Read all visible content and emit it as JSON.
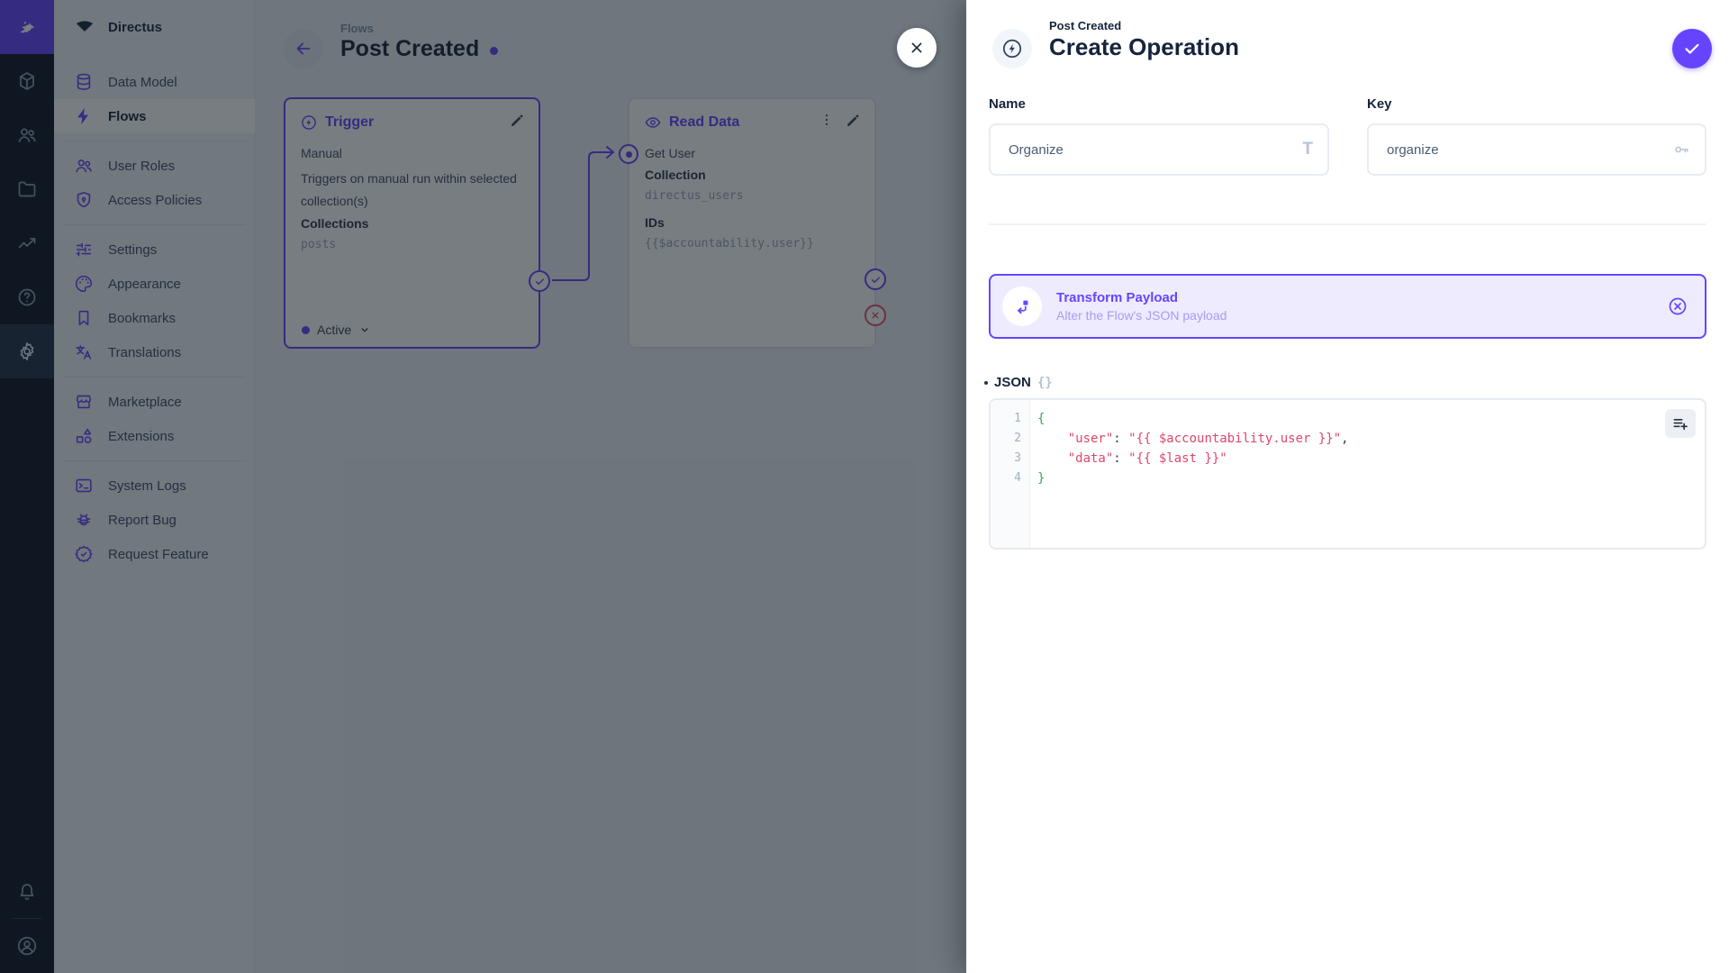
{
  "colors": {
    "accent": "#6644ff",
    "danger": "#e35169",
    "code_green": "#3ba55d",
    "code_red": "#de476b"
  },
  "sidebar": {
    "title": "Directus",
    "items": [
      {
        "label": "Data Model"
      },
      {
        "label": "Flows"
      },
      {
        "label": "User Roles"
      },
      {
        "label": "Access Policies"
      },
      {
        "label": "Settings"
      },
      {
        "label": "Appearance"
      },
      {
        "label": "Bookmarks"
      },
      {
        "label": "Translations"
      },
      {
        "label": "Marketplace"
      },
      {
        "label": "Extensions"
      },
      {
        "label": "System Logs"
      },
      {
        "label": "Report Bug"
      },
      {
        "label": "Request Feature"
      }
    ]
  },
  "flow_header": {
    "breadcrumb": "Flows",
    "title": "Post Created"
  },
  "trigger_panel": {
    "header": "Trigger",
    "type": "Manual",
    "description": "Triggers on manual run within selected collection(s)",
    "collections_label": "Collections",
    "collections_value": "posts",
    "status": "Active"
  },
  "read_data_panel": {
    "header": "Read Data",
    "name": "Get User",
    "collection_label": "Collection",
    "collection_value": "directus_users",
    "ids_label": "IDs",
    "ids_value": "{{$accountability.user}}"
  },
  "drawer": {
    "breadcrumb": "Post Created",
    "title": "Create Operation",
    "name_label": "Name",
    "name_value": "Organize",
    "key_label": "Key",
    "key_value": "organize",
    "banner": {
      "title": "Transform Payload",
      "subtitle": "Alter the Flow's JSON payload"
    },
    "json_label": "JSON",
    "braces_glyph": "{}",
    "editor": {
      "line_numbers": [
        "1",
        "2",
        "3",
        "4"
      ],
      "l1": "{",
      "l2_key": "    \"user\"",
      "l2_sep": ": ",
      "l2_str": "\"{{ $accountability.user }}\"",
      "l2_comma": ",",
      "l3_key": "    \"data\"",
      "l3_sep": ": ",
      "l3_str": "\"{{ $last }}\"",
      "l4": "}"
    }
  }
}
